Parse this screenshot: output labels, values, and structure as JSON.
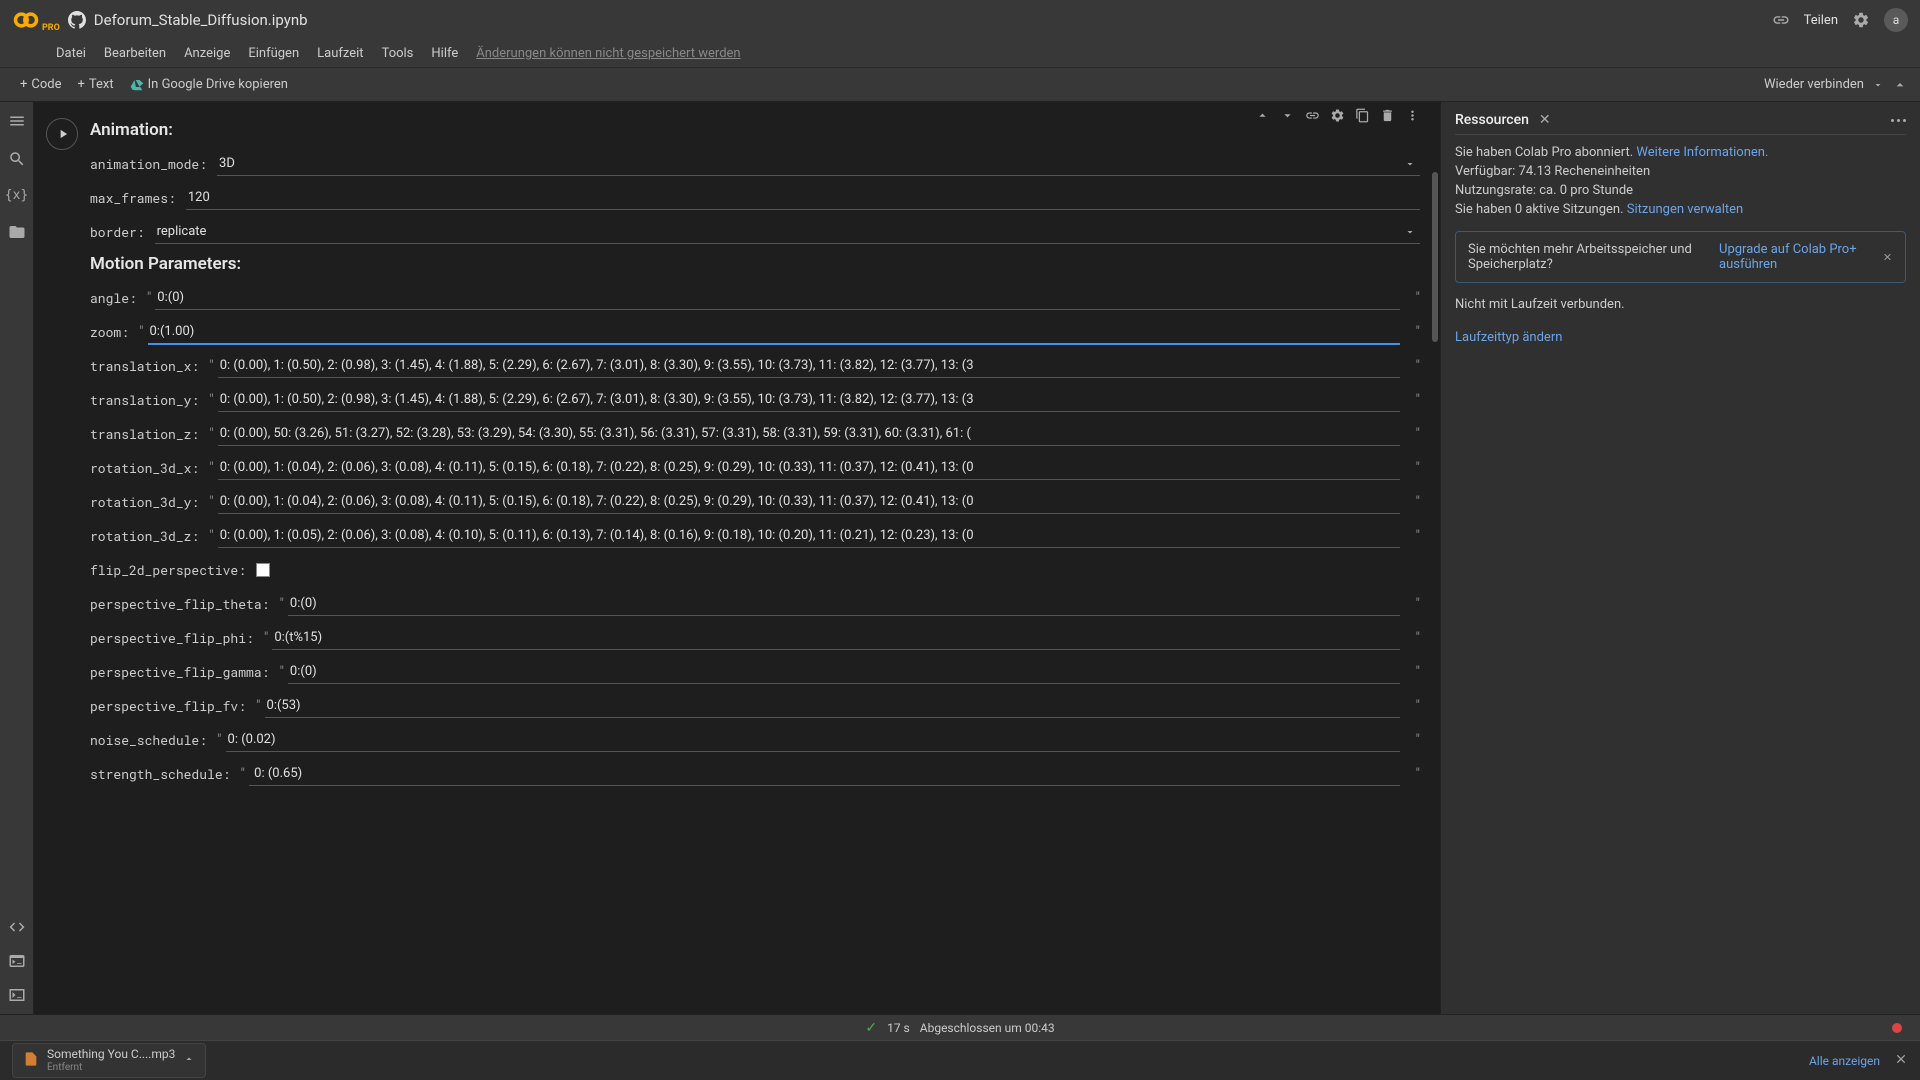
{
  "header": {
    "logo_sub": "PRO",
    "filename": "Deforum_Stable_Diffusion.ipynb",
    "share": "Teilen"
  },
  "menu": {
    "datei": "Datei",
    "bearbeiten": "Bearbeiten",
    "anzeige": "Anzeige",
    "einfugen": "Einfügen",
    "laufzeit": "Laufzeit",
    "tools": "Tools",
    "hilfe": "Hilfe",
    "warn": "Änderungen können nicht gespeichert werden"
  },
  "toolbar": {
    "code": "Code",
    "text": "Text",
    "drive": "In Google Drive kopieren",
    "reconnect": "Wieder verbinden"
  },
  "sections": {
    "animation": "Animation:",
    "motion": "Motion Parameters:"
  },
  "form": {
    "animation_mode": {
      "label": "animation_mode:",
      "value": "3D"
    },
    "max_frames": {
      "label": "max_frames:",
      "value": "120"
    },
    "border": {
      "label": "border:",
      "value": "replicate"
    },
    "angle": {
      "label": "angle:",
      "value": "0:(0)"
    },
    "zoom": {
      "label": "zoom:",
      "value": "0:(1.00)"
    },
    "translation_x": {
      "label": "translation_x:",
      "value": "0: (0.00), 1: (0.50), 2: (0.98), 3: (1.45), 4: (1.88), 5: (2.29), 6: (2.67), 7: (3.01), 8: (3.30), 9: (3.55), 10: (3.73), 11: (3.82), 12: (3.77), 13: (3"
    },
    "translation_y": {
      "label": "translation_y:",
      "value": "0: (0.00), 1: (0.50), 2: (0.98), 3: (1.45), 4: (1.88), 5: (2.29), 6: (2.67), 7: (3.01), 8: (3.30), 9: (3.55), 10: (3.73), 11: (3.82), 12: (3.77), 13: (3"
    },
    "translation_z": {
      "label": "translation_z:",
      "value": "0: (0.00), 50: (3.26), 51: (3.27), 52: (3.28), 53: (3.29), 54: (3.30), 55: (3.31), 56: (3.31), 57: (3.31), 58: (3.31), 59: (3.31), 60: (3.31), 61: ("
    },
    "rotation_3d_x": {
      "label": "rotation_3d_x:",
      "value": "0: (0.00), 1: (0.04), 2: (0.06), 3: (0.08), 4: (0.11), 5: (0.15), 6: (0.18), 7: (0.22), 8: (0.25), 9: (0.29), 10: (0.33), 11: (0.37), 12: (0.41), 13: (0"
    },
    "rotation_3d_y": {
      "label": "rotation_3d_y:",
      "value": "0: (0.00), 1: (0.04), 2: (0.06), 3: (0.08), 4: (0.11), 5: (0.15), 6: (0.18), 7: (0.22), 8: (0.25), 9: (0.29), 10: (0.33), 11: (0.37), 12: (0.41), 13: (0"
    },
    "rotation_3d_z": {
      "label": "rotation_3d_z:",
      "value": "0: (0.00), 1: (0.05), 2: (0.06), 3: (0.08), 4: (0.10), 5: (0.11), 6: (0.13), 7: (0.14), 8: (0.16), 9: (0.18), 10: (0.20), 11: (0.21), 12: (0.23), 13: (0"
    },
    "flip_2d_perspective": {
      "label": "flip_2d_perspective:"
    },
    "perspective_flip_theta": {
      "label": "perspective_flip_theta:",
      "value": "0:(0)"
    },
    "perspective_flip_phi": {
      "label": "perspective_flip_phi:",
      "value": "0:(t%15)"
    },
    "perspective_flip_gamma": {
      "label": "perspective_flip_gamma:",
      "value": "0:(0)"
    },
    "perspective_flip_fv": {
      "label": "perspective_flip_fv:",
      "value": "0:(53)"
    },
    "noise_schedule": {
      "label": "noise_schedule:",
      "value": "0: (0.02)"
    },
    "strength_schedule": {
      "label": "strength_schedule:",
      "value": " 0: (0.65)"
    }
  },
  "resources": {
    "title": "Ressourcen",
    "line1a": "Sie haben Colab Pro abonniert.",
    "line1b": "Weitere Informationen.",
    "line2": "Verfügbar: 74.13 Recheneinheiten",
    "line3": "Nutzungsrate: ca. 0 pro Stunde",
    "line4a": "Sie haben 0 aktive Sitzungen.",
    "line4b": "Sitzungen verwalten",
    "upgrade_q": "Sie möchten mehr Arbeitsspeicher und Speicherplatz?",
    "upgrade_btn": "Upgrade auf Colab Pro+ ausführen",
    "line5": "Nicht mit Laufzeit verbunden.",
    "line6": "Laufzeittyp ändern"
  },
  "status": {
    "seconds": "17 s",
    "done": "Abgeschlossen um 00:43"
  },
  "download": {
    "file": "Something You C....mp3",
    "sub": "Entfernt",
    "showall": "Alle anzeigen"
  },
  "avatar_letter": "a"
}
